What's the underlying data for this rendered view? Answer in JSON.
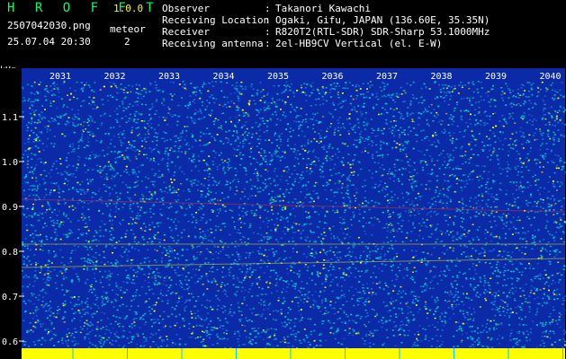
{
  "app": {
    "title": "H R O F F T",
    "version": "1.0.0"
  },
  "file": {
    "name": "2507042030.png",
    "datetime": "25.07.04 20:30"
  },
  "meteor": {
    "label": "meteor",
    "count": "2"
  },
  "info": [
    {
      "key": "Observer",
      "sep": ":",
      "value": "Takanori Kawachi"
    },
    {
      "key": "Receiving Location",
      "sep": ":",
      "value": "Ogaki, Gifu, JAPAN (136.60E, 35.35N)"
    },
    {
      "key": "Receiver",
      "sep": ":",
      "value": "R820T2(RTL-SDR) SDR-Sharp 53.1000MHz"
    },
    {
      "key": "Receiving antenna",
      "sep": ":",
      "value": "2el-HB9CV Vertical (el. E-W)"
    }
  ],
  "spectrogram": {
    "y_unit": "kHz",
    "y_ticks": [
      "1.1",
      "1.0",
      "0.9",
      "0.8",
      "0.7",
      "0.6"
    ],
    "x_ticks": [
      "2031",
      "2032",
      "2033",
      "2034",
      "2035",
      "2036",
      "2037",
      "2038",
      "2039",
      "2040"
    ],
    "colors": {
      "background": "#0a2aa8",
      "noise_mid": "#00c8c8",
      "noise_high": "#ffff00",
      "band": "#ffff00",
      "meteor_trace": "#ff3030"
    }
  }
}
